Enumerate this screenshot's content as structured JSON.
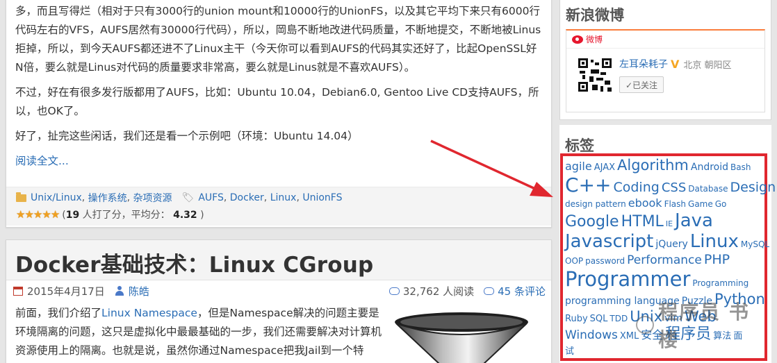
{
  "post1": {
    "paragraphs": [
      "多，而且写得烂（相对于只有3000行的union mount和10000行的UnionFS，以及其它平均下来只有6000行代码左右的VFS，AUFS居然有30000行代码），所以，岡島不断地改进代码质量，不断地提交，不断地被Linus拒掉，所以，到今天AUFS都还进不了Linux主干（今天你可以看到AUFS的代码其实还好了，比起OpenSSL好N倍，要么就是Linus对代码的质量要求非常高，要么就是Linus就是不喜欢AUFS）。",
      "不过，好在有很多发行版都用了AUFS，比如：Ubuntu 10.04，Debian6.0, Gentoo Live CD支持AUFS，所以，也OK了。",
      "好了，扯完这些闲话，我们还是看一个示例吧（环境：Ubuntu 14.04）"
    ],
    "read_more": "阅读全文...",
    "categories": [
      "Unix/Linux",
      "操作系统",
      "杂项资源"
    ],
    "tags": [
      "AUFS",
      "Docker",
      "Linux",
      "UnionFS"
    ],
    "rating": {
      "stars": 5,
      "count": "19",
      "count_suffix": " 人打了分，平均分：",
      "open_paren": "(",
      "average": "4.32",
      "close_paren": " )"
    }
  },
  "post2": {
    "title": "Docker基础技术：Linux CGroup",
    "date": "2015年4月17日",
    "author": "陈皓",
    "reads": "32,762 人阅读",
    "comments": "45 条评论",
    "body_prefix": "前面，我们介绍了",
    "body_link": "Linux Namespace",
    "body_rest": "，但是Namespace解决的问题主要是环境隔离的问题，这只是虚拟化中最最基础的一步，我们还需要解决对计算机资源使用上的隔离。也就是说，虽然你通过Namespace把我Jail到一个特"
  },
  "weibo": {
    "title": "新浪微博",
    "brand": "微博",
    "user_name": "左耳朵耗子",
    "location": "北京 朝阳区",
    "follow_label": "✓已关注"
  },
  "tags_widget": {
    "title": "标签",
    "lines": [
      [
        {
          "t": "agile",
          "s": 16
        },
        {
          "t": "AJAX",
          "s": 13
        },
        {
          "t": "Algorithm",
          "s": 21
        },
        {
          "t": "Android",
          "s": 14
        },
        {
          "t": "Bash",
          "s": 12
        }
      ],
      [
        {
          "t": "C++",
          "s": 28
        },
        {
          "t": "Coding",
          "s": 19
        },
        {
          "t": "CSS",
          "s": 18
        },
        {
          "t": "Database",
          "s": 12
        },
        {
          "t": "Design",
          "s": 19
        }
      ],
      [
        {
          "t": "design pattern",
          "s": 12
        },
        {
          "t": "ebook",
          "s": 16
        },
        {
          "t": "Flash",
          "s": 12
        },
        {
          "t": "Game",
          "s": 12
        },
        {
          "t": "Go",
          "s": 12
        }
      ],
      [
        {
          "t": "Google",
          "s": 22
        },
        {
          "t": "HTML",
          "s": 22
        },
        {
          "t": "IE",
          "s": 11
        },
        {
          "t": "Java",
          "s": 26
        }
      ],
      [
        {
          "t": "Javascript",
          "s": 26
        },
        {
          "t": "jQuery",
          "s": 14
        },
        {
          "t": "Linux",
          "s": 26
        },
        {
          "t": "MySQL",
          "s": 12
        }
      ],
      [
        {
          "t": "OOP",
          "s": 12
        },
        {
          "t": "password",
          "s": 12
        },
        {
          "t": "Performance",
          "s": 17
        },
        {
          "t": "PHP",
          "s": 19
        }
      ],
      [
        {
          "t": "Programmer",
          "s": 29
        },
        {
          "t": "Programming",
          "s": 12
        }
      ],
      [
        {
          "t": "programming language",
          "s": 14
        },
        {
          "t": "Puzzle",
          "s": 14
        },
        {
          "t": "Python",
          "s": 21
        }
      ],
      [
        {
          "t": "Ruby",
          "s": 13
        },
        {
          "t": "SQL",
          "s": 13
        },
        {
          "t": "TDD",
          "s": 12
        },
        {
          "t": "Unix",
          "s": 21
        },
        {
          "t": "vim",
          "s": 14
        },
        {
          "t": "Web",
          "s": 21
        }
      ],
      [
        {
          "t": "Windows",
          "s": 17
        },
        {
          "t": "XML",
          "s": 13
        },
        {
          "t": "安全",
          "s": 16
        },
        {
          "t": "程序员",
          "s": 22
        },
        {
          "t": "算法",
          "s": 13
        },
        {
          "t": "面",
          "s": 13
        }
      ],
      [
        {
          "t": "试",
          "s": 13
        }
      ]
    ]
  },
  "watermark": {
    "text": "程序员 书楼"
  },
  "colors": {
    "link": "#2a6db5",
    "highlight": "#e0272f",
    "star": "#f0a020"
  }
}
